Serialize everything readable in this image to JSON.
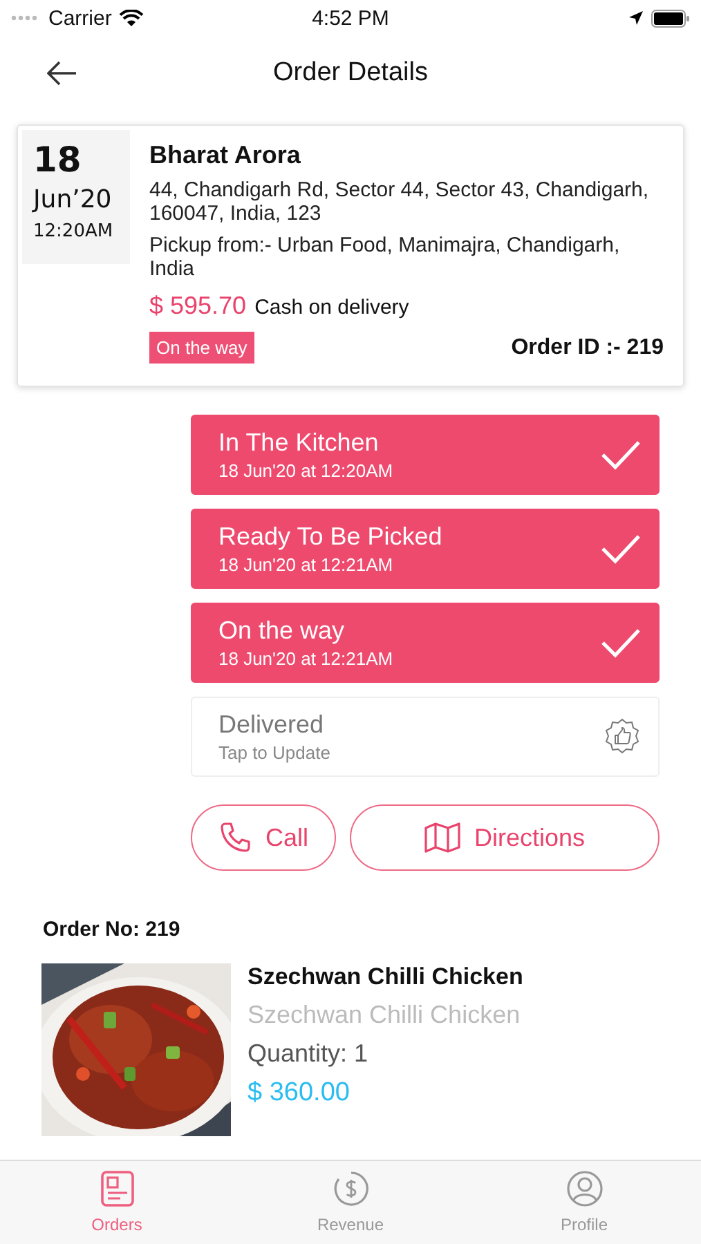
{
  "status_bar": {
    "carrier": "Carrier",
    "time": "4:52 PM"
  },
  "header": {
    "title": "Order Details"
  },
  "order_card": {
    "day": "18",
    "month": "Jun’20",
    "time": "12:20AM",
    "customer": "Bharat Arora",
    "address": "44, Chandigarh Rd, Sector 44, Sector 43, Chandigarh, 160047, India, 123",
    "pickup": "Pickup from:- Urban Food, Manimajra, Chandigarh, India",
    "amount": "$ 595.70",
    "payment": "Cash on delivery",
    "status": "On the way",
    "order_id": "Order ID :- 219"
  },
  "steps": [
    {
      "title": "In The Kitchen",
      "subtitle": "18 Jun'20 at 12:20AM",
      "done": true
    },
    {
      "title": "Ready To Be Picked",
      "subtitle": "18 Jun'20 at 12:21AM",
      "done": true
    },
    {
      "title": "On the way",
      "subtitle": "18 Jun'20 at 12:21AM",
      "done": true
    },
    {
      "title": "Delivered",
      "subtitle": "Tap to Update",
      "done": false
    }
  ],
  "actions": [
    {
      "kind": "call",
      "label": "Call"
    },
    {
      "kind": "directions",
      "label": "Directions"
    }
  ],
  "order_no": "Order No: 219",
  "items": [
    {
      "kind": "picture",
      "name": "Szechwan Chilli Chicken",
      "description": "Szechwan Chilli Chicken",
      "quantity": "Quantity: 1",
      "price": "$ 360.00"
    }
  ],
  "tabs": [
    {
      "kind": "orders",
      "label": "Orders",
      "selected": true
    },
    {
      "kind": "revenue",
      "label": "Revenue",
      "selected": false
    },
    {
      "kind": "profile",
      "label": "Profile",
      "selected": false
    }
  ]
}
